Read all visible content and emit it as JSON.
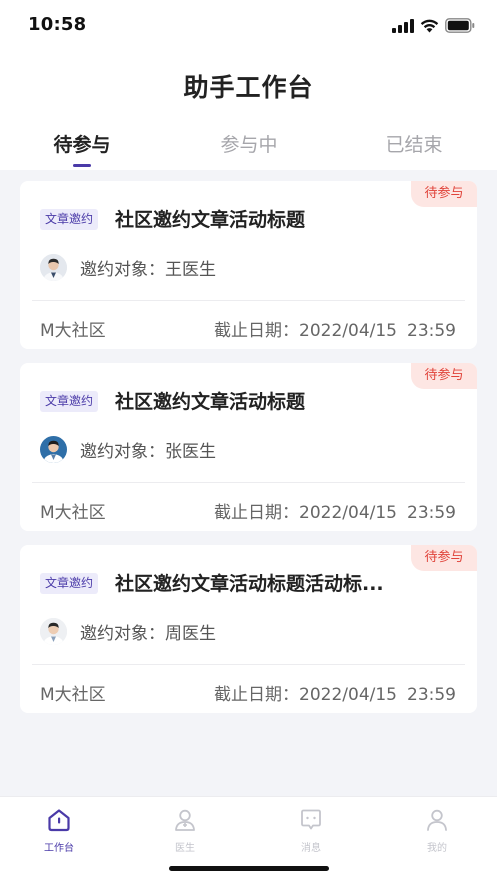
{
  "status_bar": {
    "time": "10:58"
  },
  "page": {
    "title": "助手工作台"
  },
  "tabs": [
    {
      "label": "待参与",
      "active": true
    },
    {
      "label": "参与中",
      "active": false
    },
    {
      "label": "已结束",
      "active": false
    }
  ],
  "cards": [
    {
      "badge": "待参与",
      "tag": "文章邀约",
      "title": "社区邀约文章活动标题",
      "invite": "邀约对象：王医生",
      "community": "M大社区",
      "deadline_label": "截止日期：2022/04/15",
      "deadline_time": "23:59"
    },
    {
      "badge": "待参与",
      "tag": "文章邀约",
      "title": "社区邀约文章活动标题",
      "invite": "邀约对象：张医生",
      "community": "M大社区",
      "deadline_label": "截止日期：2022/04/15",
      "deadline_time": "23:59"
    },
    {
      "badge": "待参与",
      "tag": "文章邀约",
      "title": "社区邀约文章活动标题活动标...",
      "invite": "邀约对象：周医生",
      "community": "M大社区",
      "deadline_label": "截止日期：2022/04/15",
      "deadline_time": "23:59"
    }
  ],
  "bottom_nav": [
    {
      "label": "工作台",
      "icon": "home-icon",
      "active": true
    },
    {
      "label": "医生",
      "icon": "doctor-icon",
      "active": false
    },
    {
      "label": "消息",
      "icon": "message-icon",
      "active": false
    },
    {
      "label": "我的",
      "icon": "profile-icon",
      "active": false
    }
  ],
  "colors": {
    "accent": "#4a3aa8",
    "badge_text": "#e0433a",
    "badge_bg": "#fde6e3",
    "tag_bg": "#ecebfa",
    "page_bg": "#f3f4f8"
  }
}
